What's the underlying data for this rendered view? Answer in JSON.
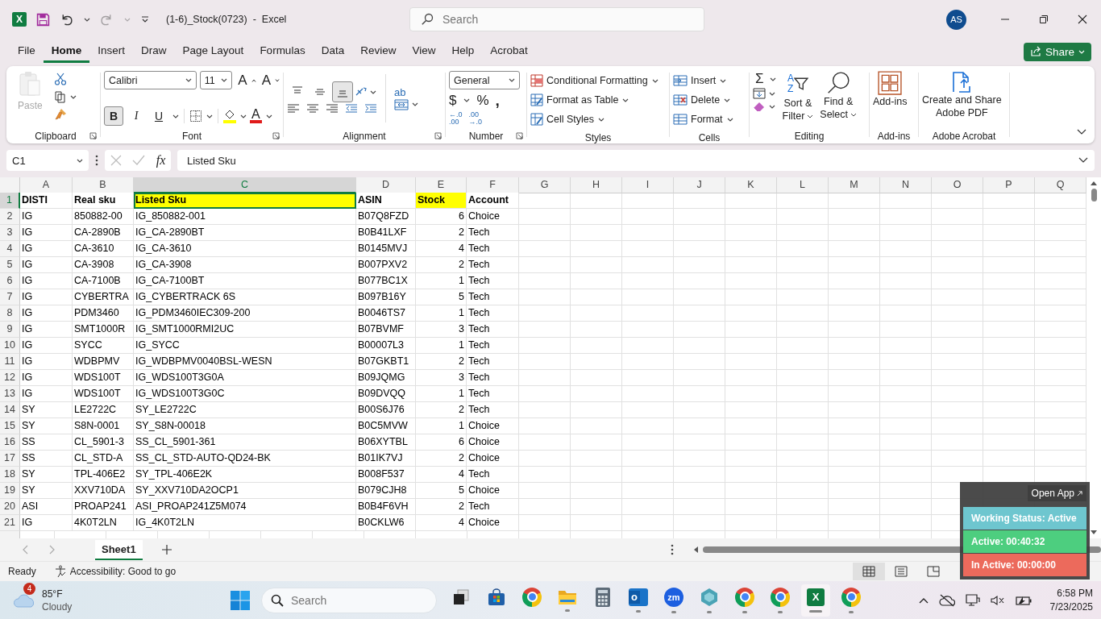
{
  "title_bar": {
    "app_glyph": "X",
    "document_title": "(1-6)_Stock(0723)  -  Excel",
    "search_placeholder": "Search",
    "avatar_initials": "AS",
    "redo_disabled": true
  },
  "menu_tabs": [
    {
      "label": "File",
      "selected": false
    },
    {
      "label": "Home",
      "selected": true
    },
    {
      "label": "Insert",
      "selected": false
    },
    {
      "label": "Draw",
      "selected": false
    },
    {
      "label": "Page Layout",
      "selected": false
    },
    {
      "label": "Formulas",
      "selected": false
    },
    {
      "label": "Data",
      "selected": false
    },
    {
      "label": "Review",
      "selected": false
    },
    {
      "label": "View",
      "selected": false
    },
    {
      "label": "Help",
      "selected": false
    },
    {
      "label": "Acrobat",
      "selected": false
    }
  ],
  "share_button": "Share",
  "ribbon": {
    "clipboard": {
      "label": "Clipboard",
      "paste": "Paste",
      "paste_disabled": true
    },
    "font": {
      "label": "Font",
      "name": "Calibri",
      "size": "11",
      "grow_glyph": "A",
      "shrink_glyph": "A",
      "color_glyph": "A",
      "styles": [
        {
          "glyph": "B",
          "selected": true
        },
        {
          "glyph": "I",
          "selected": false
        },
        {
          "glyph": "U",
          "selected": false
        }
      ]
    },
    "alignment": {
      "label": "Alignment",
      "wrap_glyph": "ab",
      "vertical": [
        {
          "kind": "top",
          "selected": false
        },
        {
          "kind": "middle",
          "selected": false
        },
        {
          "kind": "bottom",
          "selected": true
        }
      ]
    },
    "number": {
      "label": "Number",
      "format": "General",
      "currency_glyph": "$",
      "percent_glyph": "%",
      "comma_glyph": ",",
      "increase_decimal": [
        "←.0",
        ".00"
      ],
      "decrease_decimal": [
        ".00",
        "→.0"
      ]
    },
    "styles": {
      "label": "Styles",
      "items": [
        "Conditional Formatting",
        "Format as Table",
        "Cell Styles"
      ]
    },
    "cells": {
      "label": "Cells",
      "items": [
        "Insert",
        "Delete",
        "Format"
      ]
    },
    "editing": {
      "label": "Editing",
      "sum_glyph": "Σ",
      "sort_glyphs": [
        "A",
        "Z"
      ],
      "sort_lines": [
        "Sort &",
        "Filter"
      ],
      "find_lines": [
        "Find &",
        "Select"
      ]
    },
    "add_ins": {
      "label": "Add-ins",
      "button": "Add-ins"
    },
    "acrobat": {
      "label": "Adobe Acrobat",
      "button_lines": [
        "Create and Share",
        "Adobe PDF"
      ]
    }
  },
  "formula_bar": {
    "name_box": "C1",
    "function_glyph": "fx",
    "formula": "Listed Sku"
  },
  "sheet": {
    "columns": [
      {
        "letter": "A",
        "selected": false
      },
      {
        "letter": "B",
        "selected": false
      },
      {
        "letter": "C",
        "selected": true
      },
      {
        "letter": "D",
        "selected": false
      },
      {
        "letter": "E",
        "selected": false
      },
      {
        "letter": "F",
        "selected": false
      },
      {
        "letter": "G",
        "selected": false
      },
      {
        "letter": "H",
        "selected": false
      },
      {
        "letter": "I",
        "selected": false
      },
      {
        "letter": "J",
        "selected": false
      },
      {
        "letter": "K",
        "selected": false
      },
      {
        "letter": "L",
        "selected": false
      },
      {
        "letter": "M",
        "selected": false
      },
      {
        "letter": "N",
        "selected": false
      },
      {
        "letter": "O",
        "selected": false
      },
      {
        "letter": "P",
        "selected": false
      },
      {
        "letter": "Q",
        "selected": false
      }
    ],
    "header": {
      "number": "1",
      "selected": true,
      "cells": [
        {
          "text": "DISTI",
          "highlighted": false,
          "selected": false
        },
        {
          "text": "Real sku",
          "highlighted": false,
          "selected": false
        },
        {
          "text": "Listed Sku",
          "highlighted": true,
          "selected": true
        },
        {
          "text": "ASIN",
          "highlighted": false,
          "selected": false
        },
        {
          "text": "Stock",
          "highlighted": true,
          "selected": false
        },
        {
          "text": "Account",
          "highlighted": false,
          "selected": false
        }
      ]
    },
    "rows": [
      {
        "number": "2",
        "selected": false,
        "cells": [
          "IG",
          "850882-00",
          "IG_850882-001",
          "B07Q8FZD",
          "6",
          "Choice"
        ]
      },
      {
        "number": "3",
        "selected": false,
        "cells": [
          "IG",
          "CA-2890B",
          "IG_CA-2890BT",
          "B0B41LXF",
          "2",
          "Tech"
        ]
      },
      {
        "number": "4",
        "selected": false,
        "cells": [
          "IG",
          "CA-3610",
          "IG_CA-3610",
          "B0145MVJ",
          "4",
          "Tech"
        ]
      },
      {
        "number": "5",
        "selected": false,
        "cells": [
          "IG",
          "CA-3908",
          "IG_CA-3908",
          "B007PXV2",
          "2",
          "Tech"
        ]
      },
      {
        "number": "6",
        "selected": false,
        "cells": [
          "IG",
          "CA-7100B",
          "IG_CA-7100BT",
          "B077BC1X",
          "1",
          "Tech"
        ]
      },
      {
        "number": "7",
        "selected": false,
        "cells": [
          "IG",
          "CYBERTRA",
          "IG_CYBERTRACK 6S",
          "B097B16Y",
          "5",
          "Tech"
        ]
      },
      {
        "number": "8",
        "selected": false,
        "cells": [
          "IG",
          "PDM3460",
          "IG_PDM3460IEC309-200",
          "B0046TS7",
          "1",
          "Tech"
        ]
      },
      {
        "number": "9",
        "selected": false,
        "cells": [
          "IG",
          "SMT1000R",
          "IG_SMT1000RMI2UC",
          "B07BVMF",
          "3",
          "Tech"
        ]
      },
      {
        "number": "10",
        "selected": false,
        "cells": [
          "IG",
          "SYCC",
          "IG_SYCC",
          "B00007L3",
          "1",
          "Tech"
        ]
      },
      {
        "number": "11",
        "selected": false,
        "cells": [
          "IG",
          "WDBPMV",
          "IG_WDBPMV0040BSL-WESN",
          "B07GKBT1",
          "2",
          "Tech"
        ]
      },
      {
        "number": "12",
        "selected": false,
        "cells": [
          "IG",
          "WDS100T",
          "IG_WDS100T3G0A",
          "B09JQMG",
          "3",
          "Tech"
        ]
      },
      {
        "number": "13",
        "selected": false,
        "cells": [
          "IG",
          "WDS100T",
          "IG_WDS100T3G0C",
          "B09DVQQ",
          "1",
          "Tech"
        ]
      },
      {
        "number": "14",
        "selected": false,
        "cells": [
          "SY",
          "LE2722C",
          "SY_LE2722C",
          "B00S6J76",
          "2",
          "Tech"
        ]
      },
      {
        "number": "15",
        "selected": false,
        "cells": [
          "SY",
          "S8N-0001",
          "SY_S8N-00018",
          "B0C5MVW",
          "1",
          "Choice"
        ]
      },
      {
        "number": "16",
        "selected": false,
        "cells": [
          "SS",
          "CL_5901-3",
          "SS_CL_5901-361",
          "B06XYTBL",
          "6",
          "Choice"
        ]
      },
      {
        "number": "17",
        "selected": false,
        "cells": [
          "SS",
          "CL_STD-A",
          "SS_CL_STD-AUTO-QD24-BK",
          "B01IK7VJ",
          "2",
          "Choice"
        ]
      },
      {
        "number": "18",
        "selected": false,
        "cells": [
          "SY",
          "TPL-406E2",
          "SY_TPL-406E2K",
          "B008F537",
          "4",
          "Tech"
        ]
      },
      {
        "number": "19",
        "selected": false,
        "cells": [
          "SY",
          "XXV710DA",
          "SY_XXV710DA2OCP1",
          "B079CJH8",
          "5",
          "Choice"
        ]
      },
      {
        "number": "20",
        "selected": false,
        "cells": [
          "ASI",
          "PROAP241",
          "ASI_PROAP241Z5M074",
          "B0B4F6VH",
          "2",
          "Tech"
        ]
      },
      {
        "number": "21",
        "selected": false,
        "cells": [
          "IG",
          "4K0T2LN",
          "IG_4K0T2LN",
          "B0CKLW6",
          "4",
          "Choice"
        ]
      }
    ]
  },
  "sheet_tabs": [
    {
      "label": "Sheet1",
      "selected": true
    }
  ],
  "status_bar": {
    "ready": "Ready",
    "accessibility": "Accessibility: Good to go"
  },
  "tracker": {
    "open_app": "Open App",
    "lines": [
      {
        "text": "Working Status: Active",
        "color": "#6ec6cf"
      },
      {
        "text": "Active: 00:40:32",
        "color": "#4dce7f"
      },
      {
        "text": "In Active: 00:00:00",
        "color": "#ec6a5c"
      }
    ]
  },
  "taskbar": {
    "weather": {
      "badge": "4",
      "temperature": "85°F",
      "condition": "Cloudy"
    },
    "search_placeholder": "Search",
    "apps": [
      {
        "kind": "task-view",
        "running": false,
        "selected": false
      },
      {
        "kind": "store",
        "running": false,
        "selected": false
      },
      {
        "kind": "chrome",
        "running": false,
        "selected": false
      },
      {
        "kind": "folder",
        "running": true,
        "selected": false
      },
      {
        "kind": "calculator",
        "running": false,
        "selected": false
      },
      {
        "kind": "mail",
        "glyph": "o",
        "running": true,
        "selected": false
      },
      {
        "kind": "video",
        "glyph": "zm",
        "running": true,
        "selected": false
      },
      {
        "kind": "hexagon",
        "running": true,
        "selected": false
      },
      {
        "kind": "chrome",
        "running": true,
        "selected": false
      },
      {
        "kind": "chrome",
        "running": true,
        "selected": false
      },
      {
        "kind": "sheet",
        "glyph": "X",
        "running": true,
        "selected": true
      },
      {
        "kind": "chrome",
        "running": true,
        "selected": false
      }
    ],
    "clock": {
      "time": "6:58 PM",
      "date": "7/23/2025"
    }
  }
}
